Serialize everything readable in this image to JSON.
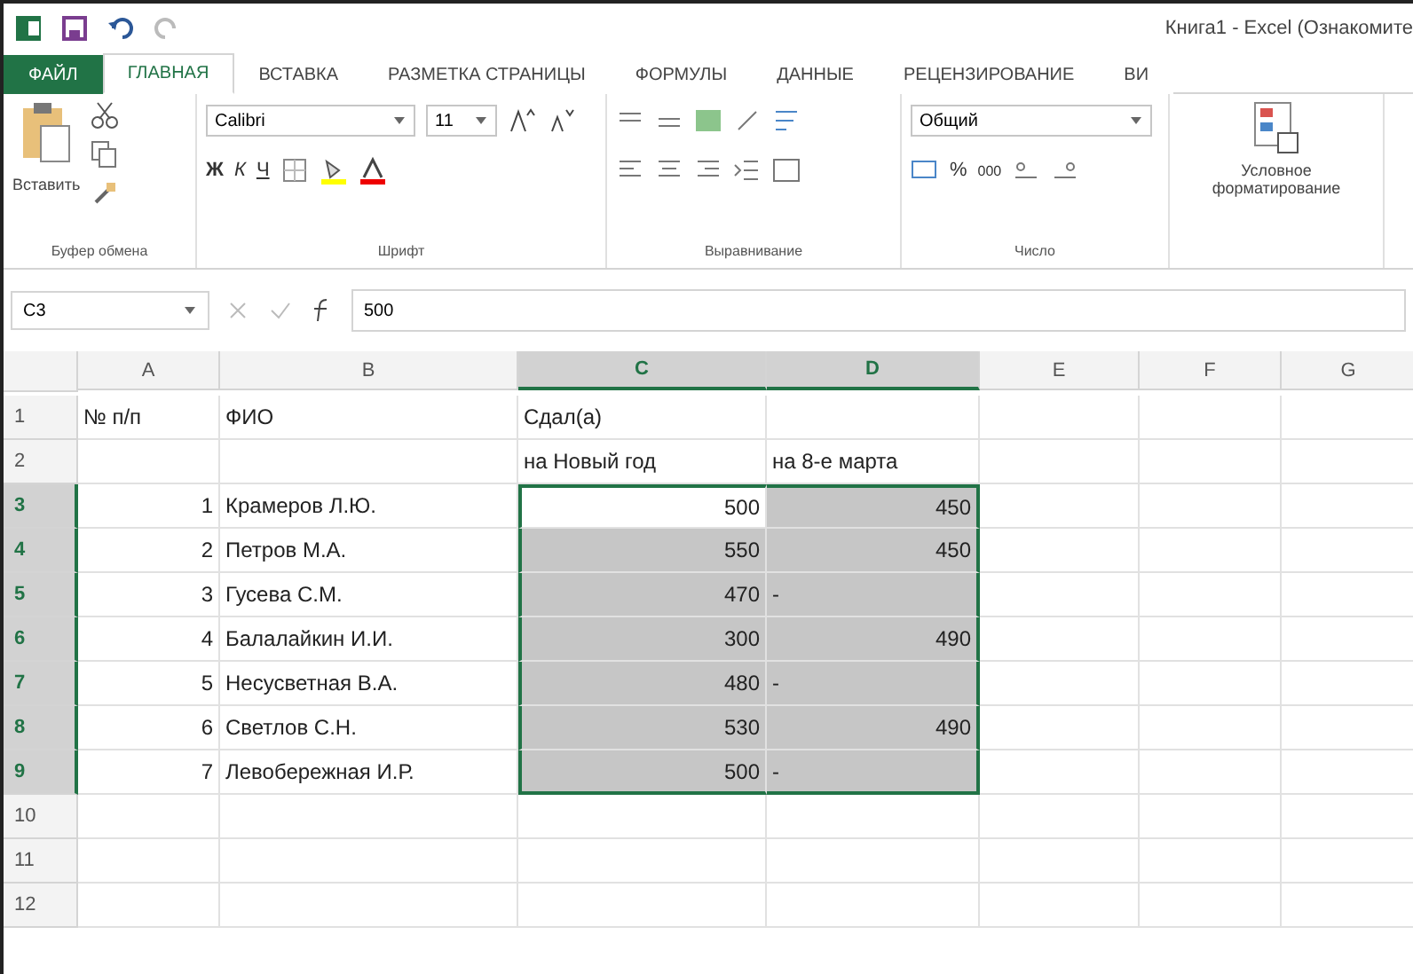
{
  "window": {
    "title": "Книга1 - Excel (Ознакомите"
  },
  "tabs": [
    {
      "label": "ФАЙЛ",
      "selected": false,
      "kind": "file"
    },
    {
      "label": "ГЛАВНАЯ",
      "selected": true,
      "kind": "tab"
    },
    {
      "label": "ВСТАВКА",
      "selected": false,
      "kind": "tab"
    },
    {
      "label": "РАЗМЕТКА СТРАНИЦЫ",
      "selected": false,
      "kind": "tab"
    },
    {
      "label": "ФОРМУЛЫ",
      "selected": false,
      "kind": "tab"
    },
    {
      "label": "ДАННЫЕ",
      "selected": false,
      "kind": "tab"
    },
    {
      "label": "РЕЦЕНЗИРОВАНИЕ",
      "selected": false,
      "kind": "tab"
    },
    {
      "label": "ВИ",
      "selected": false,
      "kind": "tab"
    }
  ],
  "ribbon": {
    "paste_label": "Вставить",
    "font_name": "Calibri",
    "font_size": "11",
    "bold": "Ж",
    "italic": "К",
    "underline": "Ч",
    "number_format": "Общий",
    "percent": "%",
    "thousands": "000",
    "conditional_label": "Условное форматирование",
    "groups": [
      "Буфер обмена",
      "Шрифт",
      "Выравнивание",
      "Число"
    ]
  },
  "formula_bar": {
    "name_box": "C3",
    "value": "500"
  },
  "sheet": {
    "columns": [
      {
        "label": "A",
        "selected": false
      },
      {
        "label": "B",
        "selected": false
      },
      {
        "label": "C",
        "selected": true
      },
      {
        "label": "D",
        "selected": true
      },
      {
        "label": "E",
        "selected": false
      },
      {
        "label": "F",
        "selected": false
      },
      {
        "label": "G",
        "selected": false
      }
    ],
    "rows": [
      {
        "number": "1",
        "selected": false,
        "cells": [
          {
            "text": "№ п/п",
            "kind": "text"
          },
          {
            "text": "ФИО",
            "kind": "text"
          },
          {
            "text": "Сдал(а)",
            "kind": "text"
          },
          {},
          {},
          {},
          {}
        ]
      },
      {
        "number": "2",
        "selected": false,
        "cells": [
          {},
          {},
          {
            "text": "на Новый год",
            "kind": "text"
          },
          {
            "text": "на 8-е марта",
            "kind": "text"
          },
          {},
          {},
          {}
        ]
      },
      {
        "number": "3",
        "selected": true,
        "cells": [
          {
            "text": "1",
            "kind": "number"
          },
          {
            "text": "Крамеров Л.Ю.",
            "kind": "text"
          },
          {
            "text": "500",
            "kind": "number",
            "selected": true,
            "active": true
          },
          {
            "text": "450",
            "kind": "number",
            "selected": true,
            "active": false
          },
          {},
          {},
          {}
        ]
      },
      {
        "number": "4",
        "selected": true,
        "cells": [
          {
            "text": "2",
            "kind": "number"
          },
          {
            "text": "Петров М.А.",
            "kind": "text"
          },
          {
            "text": "550",
            "kind": "number",
            "selected": true,
            "active": false
          },
          {
            "text": "450",
            "kind": "number",
            "selected": true,
            "active": false
          },
          {},
          {},
          {}
        ]
      },
      {
        "number": "5",
        "selected": true,
        "cells": [
          {
            "text": "3",
            "kind": "number"
          },
          {
            "text": "Гусева С.М.",
            "kind": "text"
          },
          {
            "text": "470",
            "kind": "number",
            "selected": true,
            "active": false
          },
          {
            "text": "-",
            "kind": "text",
            "selected": true,
            "active": false
          },
          {},
          {},
          {}
        ]
      },
      {
        "number": "6",
        "selected": true,
        "cells": [
          {
            "text": "4",
            "kind": "number"
          },
          {
            "text": "Балалайкин И.И.",
            "kind": "text"
          },
          {
            "text": "300",
            "kind": "number",
            "selected": true,
            "active": false
          },
          {
            "text": "490",
            "kind": "number",
            "selected": true,
            "active": false
          },
          {},
          {},
          {}
        ]
      },
      {
        "number": "7",
        "selected": true,
        "cells": [
          {
            "text": "5",
            "kind": "number"
          },
          {
            "text": "Несусветная В.А.",
            "kind": "text"
          },
          {
            "text": "480",
            "kind": "number",
            "selected": true,
            "active": false
          },
          {
            "text": "-",
            "kind": "text",
            "selected": true,
            "active": false
          },
          {},
          {},
          {}
        ]
      },
      {
        "number": "8",
        "selected": true,
        "cells": [
          {
            "text": "6",
            "kind": "number"
          },
          {
            "text": "Светлов С.Н.",
            "kind": "text"
          },
          {
            "text": "530",
            "kind": "number",
            "selected": true,
            "active": false
          },
          {
            "text": "490",
            "kind": "number",
            "selected": true,
            "active": false
          },
          {},
          {},
          {}
        ]
      },
      {
        "number": "9",
        "selected": true,
        "cells": [
          {
            "text": "7",
            "kind": "number"
          },
          {
            "text": "Левобережная И.Р.",
            "kind": "text"
          },
          {
            "text": "500",
            "kind": "number",
            "selected": true,
            "active": false
          },
          {
            "text": "-",
            "kind": "text",
            "selected": true,
            "active": false
          },
          {},
          {},
          {}
        ]
      },
      {
        "number": "10",
        "selected": false,
        "cells": [
          {},
          {},
          {},
          {},
          {},
          {},
          {}
        ]
      },
      {
        "number": "11",
        "selected": false,
        "cells": [
          {},
          {},
          {},
          {},
          {},
          {},
          {}
        ]
      },
      {
        "number": "12",
        "selected": false,
        "cells": [
          {},
          {},
          {},
          {},
          {},
          {},
          {}
        ]
      }
    ]
  }
}
